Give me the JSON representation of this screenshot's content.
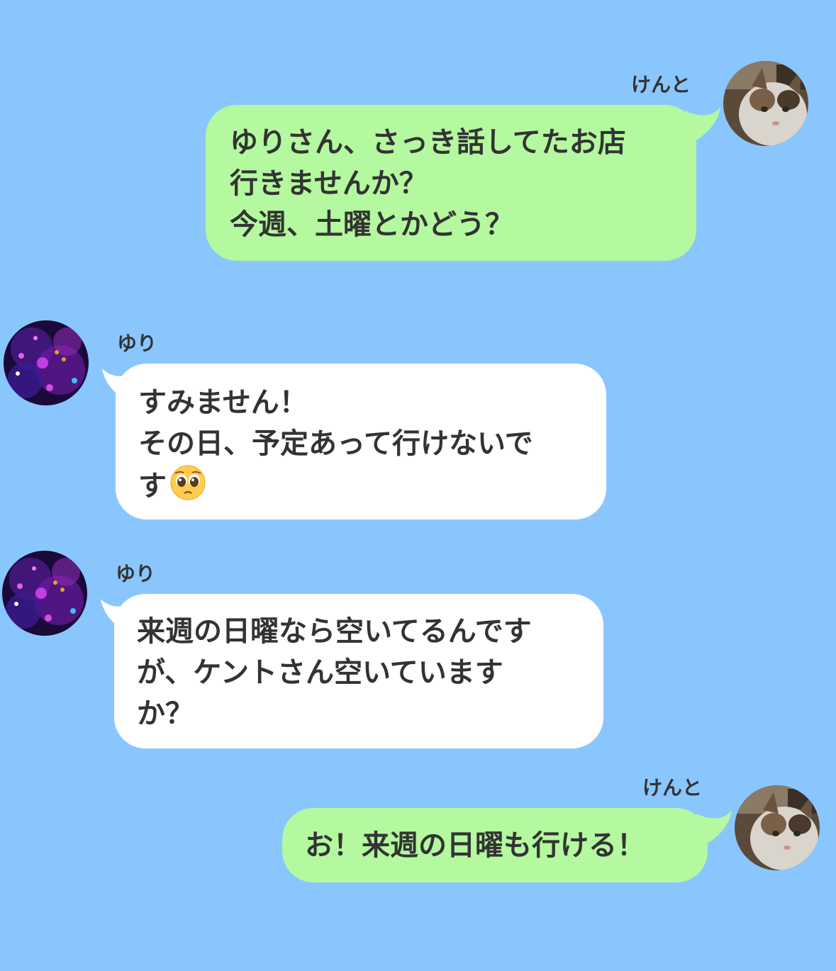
{
  "colors": {
    "background": "#8AC6FE",
    "sent_bubble": "#B4F89F",
    "received_bubble": "#FFFFFF",
    "text": "#333333"
  },
  "messages": [
    {
      "sender": "けんと",
      "direction": "sent",
      "avatar": "cat-avatar",
      "lines": [
        "ゆりさん、さっき話してたお店",
        "行きませんか？",
        "今週、土曜とかどう？"
      ]
    },
    {
      "sender": "ゆり",
      "direction": "received",
      "avatar": "galaxy-avatar",
      "lines": [
        "すみません！",
        "その日、予定あって行けないで",
        "す"
      ],
      "emoji": "pleading-face-emoji"
    },
    {
      "sender": "ゆり",
      "direction": "received",
      "avatar": "galaxy-avatar",
      "lines": [
        "来週の日曜なら空いてるんです",
        "が、ケントさん空いています",
        "か？"
      ]
    },
    {
      "sender": "けんと",
      "direction": "sent",
      "avatar": "cat-avatar",
      "lines": [
        "お！来週の日曜も行ける！"
      ]
    }
  ]
}
